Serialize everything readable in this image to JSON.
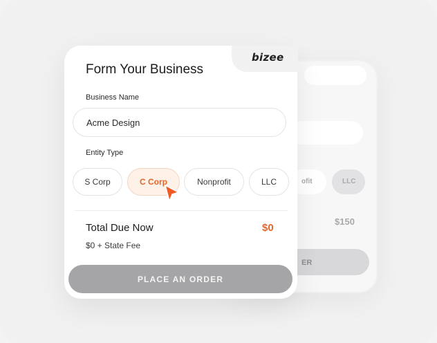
{
  "brand": {
    "logo_text": "bizee"
  },
  "form": {
    "title": "Form Your Business",
    "business_name_label": "Business Name",
    "business_name_value": "Acme Design",
    "entity_type_label": "Entity Type",
    "entity_options": [
      "S Corp",
      "C Corp",
      "Nonprofit",
      "LLC"
    ],
    "selected_entity": "C Corp"
  },
  "summary": {
    "total_label": "Total Due Now",
    "total_value": "$0",
    "fee_note": "$0 + State Fee"
  },
  "cta": {
    "label": "PLACE AN ORDER"
  },
  "back_card": {
    "chip_partial": "ofit",
    "chip_llc": "LLC",
    "price": "$150",
    "button_partial": "ER"
  },
  "colors": {
    "accent": "#e5672a",
    "button_disabled": "#a5a5a7"
  },
  "icons": {
    "cursor": "pointer-cursor-icon"
  }
}
